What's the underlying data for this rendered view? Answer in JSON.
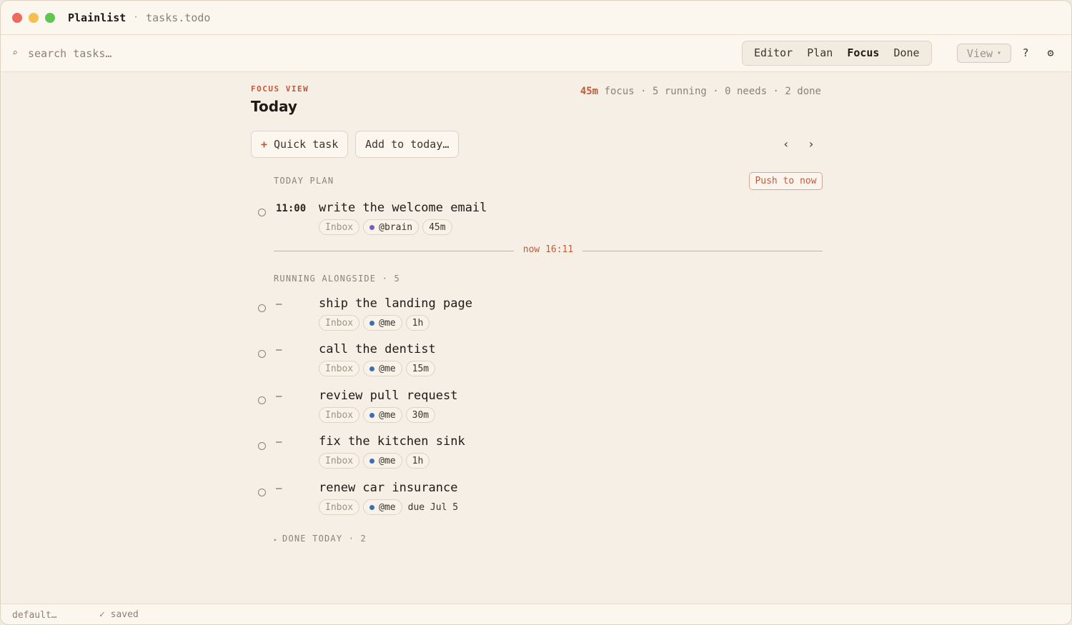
{
  "window": {
    "app_name": "Plainlist",
    "separator": "·",
    "file_name": "tasks.todo"
  },
  "toolbar": {
    "search_placeholder": "search tasks…",
    "search_icon": "⌕",
    "modes": [
      "Editor",
      "Plan",
      "Focus",
      "Done"
    ],
    "active_mode": "Focus",
    "view_label": "View",
    "view_caret": "▾",
    "help_label": "?",
    "settings_icon": "⚙"
  },
  "header": {
    "eyebrow": "FOCUS VIEW",
    "title": "Today",
    "stats": {
      "focus": "45m",
      "rest": " focus · 5 running · 0 needs · 2 done"
    }
  },
  "actions": {
    "quick_task": "Quick task",
    "quick_task_plus": "+",
    "add_to_today": "Add to today…",
    "prev": "‹",
    "next": "›"
  },
  "today_plan": {
    "label": "TODAY PLAN",
    "push_label": "Push to now",
    "tasks": [
      {
        "time": "11:00",
        "title": "write the welcome email",
        "list": "Inbox",
        "assignee": "@brain",
        "duration": "45m"
      }
    ]
  },
  "now_marker": "now 16:11",
  "running": {
    "label": "RUNNING ALONGSIDE · 5",
    "tasks": [
      {
        "time": "—",
        "title": "ship the landing page",
        "list": "Inbox",
        "assignee": "@me",
        "duration": "1h"
      },
      {
        "time": "—",
        "title": "call the dentist",
        "list": "Inbox",
        "assignee": "@me",
        "duration": "15m"
      },
      {
        "time": "—",
        "title": "review pull request",
        "list": "Inbox",
        "assignee": "@me",
        "duration": "30m"
      },
      {
        "time": "—",
        "title": "fix the kitchen sink",
        "list": "Inbox",
        "assignee": "@me",
        "duration": "1h"
      },
      {
        "time": "—",
        "title": "renew car insurance",
        "list": "Inbox",
        "assignee": "@me",
        "due": "due Jul 5"
      }
    ]
  },
  "done_today": {
    "label": "DONE TODAY · 2",
    "toggle_icon": "▸"
  },
  "statusbar": {
    "profile": "default…",
    "saved": "✓ saved"
  },
  "colors": {
    "accent": "#c05a3c",
    "brain_dot": "#7a5cc0",
    "me_dot": "#3f6db3",
    "close": "#ec6a5e",
    "minimize": "#f4bf4f",
    "zoom": "#61c554"
  }
}
